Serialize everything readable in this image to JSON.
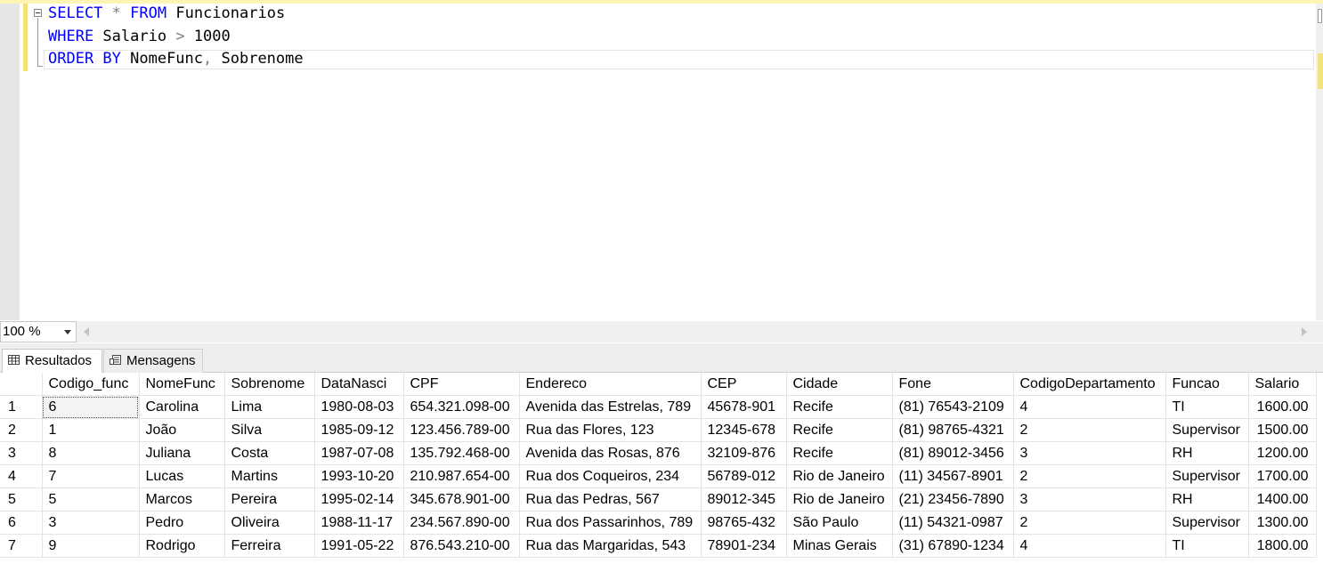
{
  "editor": {
    "lines": [
      [
        {
          "t": "SELECT",
          "c": "kw"
        },
        {
          "t": " "
        },
        {
          "t": "*",
          "c": "op"
        },
        {
          "t": " "
        },
        {
          "t": "FROM",
          "c": "kw"
        },
        {
          "t": " Funcionarios"
        }
      ],
      [
        {
          "t": "WHERE",
          "c": "kw"
        },
        {
          "t": " Salario "
        },
        {
          "t": ">",
          "c": "op"
        },
        {
          "t": " 1000"
        }
      ],
      [
        {
          "t": "ORDER BY",
          "c": "kw"
        },
        {
          "t": " NomeFunc"
        },
        {
          "t": ",",
          "c": "op"
        },
        {
          "t": " Sobrenome"
        }
      ]
    ]
  },
  "zoom": {
    "value": "100 %"
  },
  "tabs": {
    "results": "Resultados",
    "messages": "Mensagens"
  },
  "grid": {
    "columns": [
      "",
      "Codigo_func",
      "NomeFunc",
      "Sobrenome",
      "DataNasci",
      "CPF",
      "Endereco",
      "CEP",
      "Cidade",
      "Fone",
      "CodigoDepartamento",
      "Funcao",
      "Salario"
    ],
    "rows": [
      [
        "1",
        "6",
        "Carolina",
        "Lima",
        "1980-08-03",
        "654.321.098-00",
        "Avenida das Estrelas, 789",
        "45678-901",
        "Recife",
        "(81) 76543-2109",
        "4",
        "TI",
        "1600.00"
      ],
      [
        "2",
        "1",
        "João",
        "Silva",
        "1985-09-12",
        "123.456.789-00",
        "Rua das Flores, 123",
        "12345-678",
        "Recife",
        "(81) 98765-4321",
        "2",
        "Supervisor",
        "1500.00"
      ],
      [
        "3",
        "8",
        "Juliana",
        "Costa",
        "1987-07-08",
        "135.792.468-00",
        "Avenida das Rosas, 876",
        "32109-876",
        "Recife",
        "(81) 89012-3456",
        "3",
        "RH",
        "1200.00"
      ],
      [
        "4",
        "7",
        "Lucas",
        "Martins",
        "1993-10-20",
        "210.987.654-00",
        "Rua dos Coqueiros, 234",
        "56789-012",
        "Rio de Janeiro",
        "(11) 34567-8901",
        "2",
        "Supervisor",
        "1700.00"
      ],
      [
        "5",
        "5",
        "Marcos",
        "Pereira",
        "1995-02-14",
        "345.678.901-00",
        "Rua das Pedras, 567",
        "89012-345",
        "Rio de Janeiro",
        "(21) 23456-7890",
        "3",
        "RH",
        "1400.00"
      ],
      [
        "6",
        "3",
        "Pedro",
        "Oliveira",
        "1988-11-17",
        "234.567.890-00",
        "Rua dos Passarinhos, 789",
        "98765-432",
        "São Paulo",
        "(11) 54321-0987",
        "2",
        "Supervisor",
        "1300.00"
      ],
      [
        "7",
        "9",
        "Rodrigo",
        "Ferreira",
        "1991-05-22",
        "876.543.210-00",
        "Rua das Margaridas, 543",
        "78901-234",
        "Minas Gerais",
        "(31) 67890-1234",
        "4",
        "TI",
        "1800.00"
      ]
    ]
  }
}
